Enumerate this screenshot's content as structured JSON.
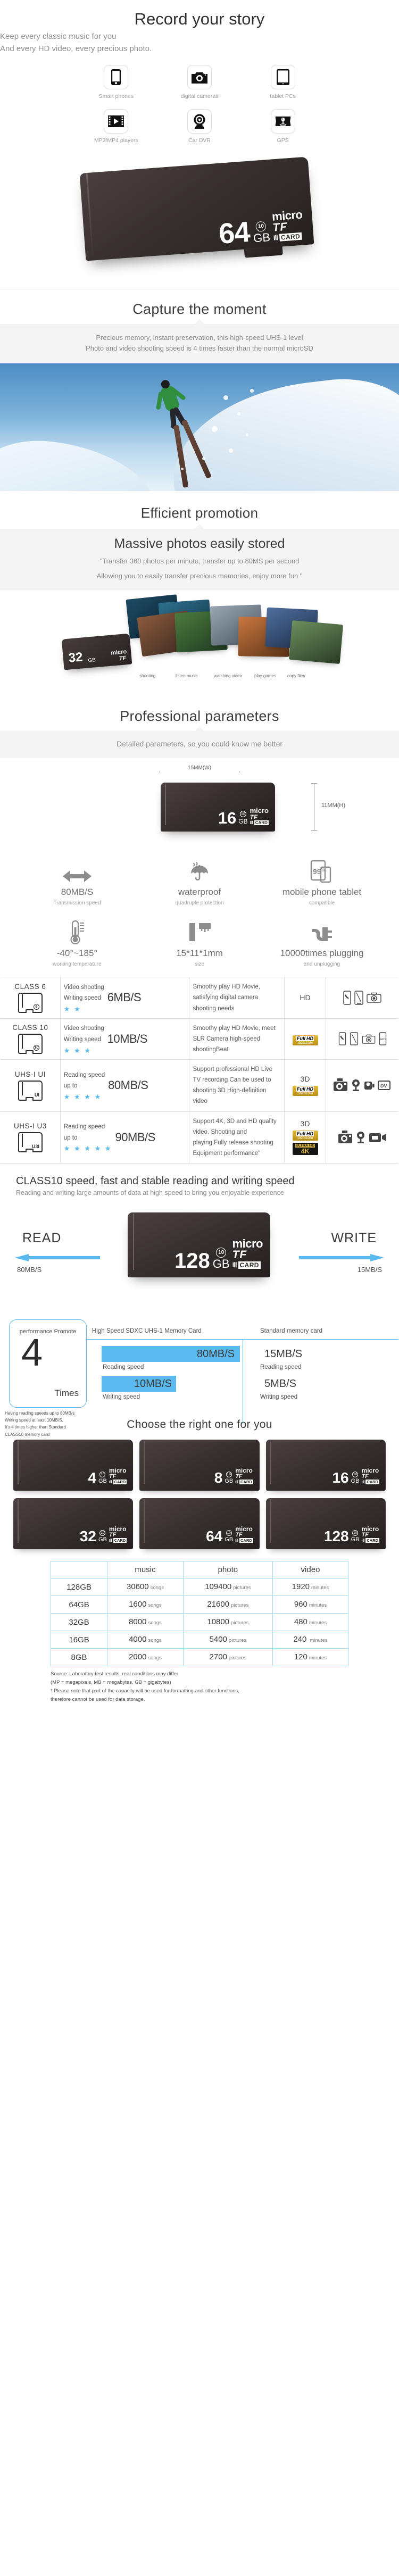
{
  "intro": {
    "title": "Record your story",
    "sub_line1": "Keep every classic music for you",
    "sub_line2": "And every HD video, every precious photo.",
    "devices": [
      {
        "icon": "smartphone-icon",
        "label": "Smart phones"
      },
      {
        "icon": "camera-icon",
        "label": "digital cameras"
      },
      {
        "icon": "tablet-icon",
        "label": "tablet PCs"
      },
      {
        "icon": "media-player-icon",
        "label": "MP3/MP4 players"
      },
      {
        "icon": "dashcam-icon",
        "label": "Car DVR"
      },
      {
        "icon": "gps-icon",
        "label": "GPS"
      }
    ]
  },
  "hero_card": {
    "capacity": "64",
    "gb": "GB",
    "class": "10",
    "micro": "micro",
    "tf": "TF",
    "u1": "IⅡ",
    "card": "CARD"
  },
  "capture": {
    "title": "Capture the moment",
    "line1": "Precious memory, instant preservation, this high-speed UHS-1 level",
    "line2": "Photo and video shooting speed is 4 times faster than the normal microSD"
  },
  "promotion": {
    "title": "Efficient promotion",
    "subtitle": "Massive photos easily stored",
    "line1": "\"Transfer 360 photos per minute, transfer up to 80MS per second",
    "line2": "Allowing you to easily transfer precious memories, enjoy more fun \"",
    "fan_card": {
      "capacity": "32",
      "gb": "GB",
      "micro": "micro",
      "tf": "TF"
    },
    "fan_labels": [
      "shooting",
      "listen music",
      "watching video",
      "play games",
      "copy files"
    ]
  },
  "parameters": {
    "title": "Professional parameters",
    "subtitle": "Detailed parameters, so you could know me better",
    "dim_width": "15MM(W)",
    "dim_height": "11MM(H)",
    "dim_card": {
      "capacity": "16",
      "gb": "GB",
      "class": "10",
      "micro": "micro",
      "tf": "TF",
      "u1": "IⅡ",
      "card": "CARD"
    },
    "features": [
      {
        "icon": "double-arrow-icon",
        "value": "80MB/S",
        "caption": "Transmission speed"
      },
      {
        "icon": "umbrella-icon",
        "value": "waterproof",
        "caption": "quadruple protection"
      },
      {
        "icon": "phone-tablet-icon",
        "value": "mobile phone tablet",
        "caption": "compatible"
      },
      {
        "icon": "thermometer-icon",
        "value": "-40°~185°",
        "caption": "working temperature"
      },
      {
        "icon": "ruler-icon",
        "value": "15*11*1mm",
        "caption": "size"
      },
      {
        "icon": "plug-icon",
        "value": "10000times plugging",
        "caption": "and unplugging"
      }
    ]
  },
  "spec_table": {
    "rows": [
      {
        "class_name": "CLASS  6",
        "card_mark": "6",
        "speed_label_1": "Video shooting",
        "speed_label_2": "Writing speed",
        "speed_value": "6MB/S",
        "stars": 2,
        "description": "Smoothy play HD Movie, satisfying digital camera shooting needs",
        "quality": "HD",
        "fullhd": false,
        "ultra4k": false,
        "devices": [
          "phone-icon",
          "phone-landscape-icon",
          "camera-icon"
        ]
      },
      {
        "class_name": "CLASS 10",
        "card_mark": "10",
        "speed_label_1": "Video shooting",
        "speed_label_2": "Writing speed",
        "speed_value": "10MB/S",
        "stars": 3,
        "description": "Smoothy play HD Movie, meet SLR Camera high-speed shootingBeat",
        "quality": "",
        "fullhd": true,
        "ultra4k": false,
        "devices": [
          "phone-icon",
          "phone-landscape-icon",
          "camera-icon",
          "gps-icon"
        ]
      },
      {
        "class_name": "UHS-I  UI",
        "card_mark": "UI",
        "speed_label_1": "Reading speed",
        "speed_label_2": "up to",
        "speed_value": "80MB/S",
        "stars": 4,
        "description": "Support professional HD Live TV recording Can be used to shooting 3D High-definition video",
        "quality": "3D",
        "fullhd": true,
        "ultra4k": false,
        "devices": [
          "dslr-icon",
          "webcam-icon",
          "camcorder-icon",
          "dv-icon"
        ]
      },
      {
        "class_name": "UHS-I  U3",
        "card_mark": "U3I",
        "speed_label_1": "Reading speed",
        "speed_label_2": "up to",
        "speed_value": "90MB/S",
        "stars": 5,
        "description": "Support 4K, 3D and HD quality video. Shooting and playing,Fully release shooting Equipment performance\"",
        "quality": "3D",
        "fullhd": true,
        "ultra4k": true,
        "devices": [
          "dslr-icon",
          "webcam-icon",
          "video-camera-icon"
        ]
      }
    ],
    "badges": {
      "fullhd_top": "Full",
      "fullhd_hd": "HD",
      "fullhd_res": "1920x1080",
      "ultra_top": "ULTRA",
      "ultra_hd": "HD",
      "ultra_4k": "4K"
    }
  },
  "readwrite": {
    "heading": "CLASS10 speed, fast and stable reading and writing speed",
    "sub": "Reading and writing large amounts of data at high speed to bring you enjoyable experience",
    "read_word": "READ",
    "write_word": "WRITE",
    "read_speed": "80MB/S",
    "write_speed": "15MB/S",
    "card": {
      "capacity": "128",
      "gb": "GB",
      "class": "10",
      "micro": "micro",
      "tf": "TF",
      "u1": "IⅡ",
      "card": "CARD"
    }
  },
  "chart_data": {
    "type": "bar",
    "title": "performance Promote",
    "promote_number": "4",
    "promote_unit": "Times",
    "categories": [
      "Reading speed",
      "Writing speed"
    ],
    "series": [
      {
        "name": "High Speed SDXC UHS-1 Memory Card",
        "values": [
          80,
          10
        ],
        "labels": [
          "80MB/S",
          "10MB/S"
        ],
        "color": "#5ab9ee"
      },
      {
        "name": "Standard memory card",
        "values": [
          15,
          5
        ],
        "labels": [
          "15MB/S",
          "5MB/S"
        ],
        "color": "#b9b9b9"
      }
    ],
    "xlabel": "",
    "ylabel": "MB/S",
    "note_lines": [
      "Having reading speeds up to 80MB/s",
      "Writing speed at least 10MB/S.",
      "It's 4 times higher than Standard",
      "CLASS10 memory card"
    ]
  },
  "choose": {
    "title": "Choose the right one for you",
    "cards": [
      {
        "capacity": "4",
        "gb": "GB",
        "class": "10",
        "micro": "micro",
        "tf": "TF",
        "u1": "IⅡ",
        "card": "CARD"
      },
      {
        "capacity": "8",
        "gb": "GB",
        "class": "10",
        "micro": "micro",
        "tf": "TF",
        "u1": "IⅡ",
        "card": "CARD"
      },
      {
        "capacity": "16",
        "gb": "GB",
        "class": "10",
        "micro": "micro",
        "tf": "TF",
        "u1": "IⅡ",
        "card": "CARD"
      },
      {
        "capacity": "32",
        "gb": "GB",
        "class": "10",
        "micro": "micro",
        "tf": "TF",
        "u1": "IⅡ",
        "card": "CARD"
      },
      {
        "capacity": "64",
        "gb": "GB",
        "class": "10",
        "micro": "micro",
        "tf": "TF",
        "u1": "IⅡ",
        "card": "CARD"
      },
      {
        "capacity": "128",
        "gb": "GB",
        "class": "10",
        "micro": "micro",
        "tf": "TF",
        "u1": "IⅡ",
        "card": "CARD"
      }
    ]
  },
  "capacity_table": {
    "headers": [
      "",
      "music",
      "photo",
      "video"
    ],
    "rows": [
      {
        "size": "128GB",
        "music_num": "30600",
        "music_unit": "songs",
        "photo_num": "109400",
        "photo_unit": "pictures",
        "video_num": "1920",
        "video_unit": "minutes"
      },
      {
        "size": "64GB",
        "music_num": "1600",
        "music_unit": "songs",
        "photo_num": "21600",
        "photo_unit": "pictures",
        "video_num": "960",
        "video_unit": "minutes"
      },
      {
        "size": "32GB",
        "music_num": "8000",
        "music_unit": "songs",
        "photo_num": "10800",
        "photo_unit": "pictures",
        "video_num": "480",
        "video_unit": "minutes"
      },
      {
        "size": "16GB",
        "music_num": "4000",
        "music_unit": "songs",
        "photo_num": "5400",
        "photo_unit": "pictures",
        "video_num": "240",
        "video_unit": "minutes"
      },
      {
        "size": "8GB",
        "music_num": "2000",
        "music_unit": "songs",
        "photo_num": "2700",
        "photo_unit": "pictures",
        "video_num": "120",
        "video_unit": "minutes"
      }
    ],
    "note_1": "Source: Laboratory test results, real conditions may differ",
    "note_2": "(MP = megapixels, MB = megabytes, GB = gigabytes)",
    "note_3": "* Please note that part of the capacity will be used for formatting and other functions,",
    "note_4": "therefore cannot be used for data storage."
  }
}
